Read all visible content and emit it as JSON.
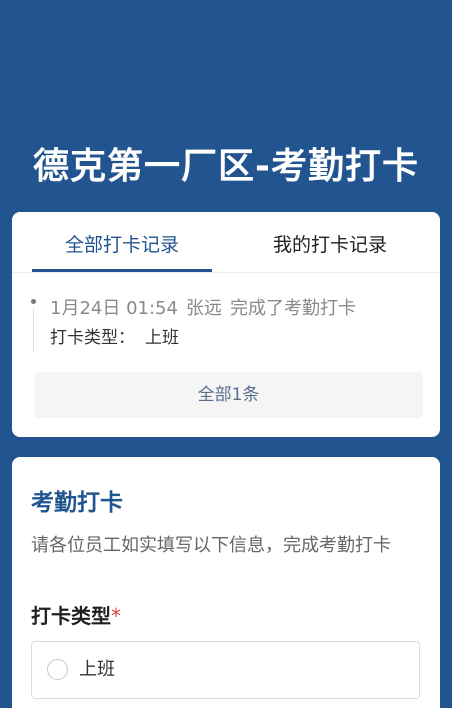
{
  "header": {
    "title": "德克第一厂区-考勤打卡"
  },
  "records": {
    "tabs": [
      {
        "label": "全部打卡记录",
        "active": true
      },
      {
        "label": "我的打卡记录",
        "active": false
      }
    ],
    "items": [
      {
        "datetime": "1月24日 01:54",
        "user": "张远",
        "action": "完成了考勤打卡",
        "type_label": "打卡类型：",
        "type_value": "上班"
      }
    ],
    "total_label": "全部1条"
  },
  "form": {
    "title": "考勤打卡",
    "description": "请各位员工如实填写以下信息，完成考勤打卡",
    "field_label": "打卡类型",
    "required_mark": "*",
    "options": [
      {
        "label": "上班",
        "selected": false
      }
    ]
  },
  "colors": {
    "background": "#22558f",
    "accent": "#22558f",
    "required": "#e0443c"
  }
}
